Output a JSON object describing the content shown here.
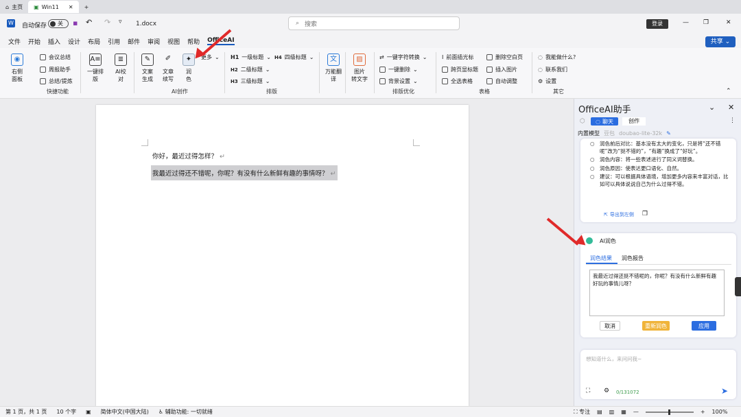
{
  "tabs": {
    "home": "主页",
    "doc": "Win11"
  },
  "titlebar": {
    "autosave": "自动保存",
    "toggle": "关",
    "filename": "1.docx",
    "search_placeholder": "搜索",
    "login": "登录",
    "share": "共享"
  },
  "menu": [
    "文件",
    "开始",
    "插入",
    "设计",
    "布局",
    "引用",
    "邮件",
    "审阅",
    "视图",
    "帮助",
    "OfficeAI"
  ],
  "ribbon": {
    "right_panel": "右侧\n面板",
    "meeting": "会议总结",
    "weekly": "周报助手",
    "summary": "总结/提炼",
    "quick": "快捷功能",
    "format": "一键排\n版",
    "proof": "AI校\n对",
    "gen": "文案\n生成",
    "cont": "文章\n续写",
    "polish": "润\n色",
    "more": "更多",
    "ai_create": "AI创作",
    "h1": "一级标题",
    "h2": "二级标题",
    "h3": "三级标题",
    "h4": "四级标题",
    "layout": "排版",
    "translate": "万能翻\n译",
    "img2txt": "图片\n转文字",
    "to_char": "一键字符转换",
    "del_one": "一键删除",
    "bg": "背景设置",
    "opt": "排版优化",
    "front": "前面插光标",
    "del_blank": "删除空白页",
    "cross": "跨页显标题",
    "insert_img": "插入图片",
    "sel_table": "全选表格",
    "auto_adjust": "自动调整",
    "table": "表格",
    "help": "我能做什么?",
    "contact": "联系我们",
    "settings": "设置",
    "other": "其它"
  },
  "doc": {
    "line1": "你好，最近过得怎样？",
    "line2": "我最近过得还不错呢，你呢？有没有什么新鲜有趣的事情呀？"
  },
  "side": {
    "title": "OfficeAI助手",
    "chat": "聊天",
    "create": "创作",
    "model_label": "内置模型",
    "model_icon": "豆包",
    "model_name": "doubao-lite-32k",
    "bullets": [
      "润色前后对比：基本没有太大的变化，只是将“还不错呢”改为“挺不错的”，“有趣”换成了“好玩”。",
      "润色内容：将一些表述进行了同义词替换。",
      "润色原因：使表达更口语化、自然。",
      "建议：可以根据具体语境，增加更多内容来丰富对话，比如可以具体说说自己为什么过得不错。"
    ],
    "export": "导出到左侧",
    "ai_polish": "AI润色",
    "tab_result": "润色结果",
    "tab_report": "润色报告",
    "result_text": "我最近过得还挺不错呢的，你呢？有没有什么新鲜有趣好玩的事情儿呀？",
    "cancel": "取消",
    "retry": "重新润色",
    "apply": "应用",
    "input_placeholder": "想知道什么，来问问我~",
    "counter": "0/131072"
  },
  "status": {
    "page": "第 1 页，共 1 页",
    "words": "10 个字",
    "lang": "简体中文(中国大陆)",
    "access": "辅助功能: 一切就绪",
    "focus": "专注",
    "zoom": "100%"
  },
  "colors": {
    "accent": "#185abd",
    "share_bg": "#1f5fbf",
    "retry": "#f0b43a",
    "apply": "#2b6de0",
    "arrow": "#e02a2a"
  }
}
